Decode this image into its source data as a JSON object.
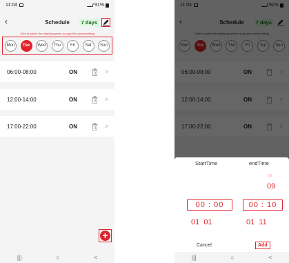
{
  "status_bar": {
    "time": "11:04",
    "battery": "91%"
  },
  "header": {
    "title": "Schedule",
    "days_badge": "7 days"
  },
  "hint": "Click to switch the date/long press to copy the current setting",
  "days": [
    "Mon",
    "Tue",
    "Wed",
    "Thu",
    "Fri",
    "Sat",
    "Sun"
  ],
  "selected_day": "Tue",
  "slots": [
    {
      "time": "06:00-08:00",
      "state": "ON"
    },
    {
      "time": "12:00-14:00",
      "state": "ON"
    },
    {
      "time": "17:00-22:00",
      "state": "ON"
    }
  ],
  "fab": {
    "label": "+"
  },
  "system_nav": {
    "recents": "|||",
    "home": "○",
    "back": "<"
  },
  "picker": {
    "start_label": "StartTime",
    "end_label": "endTime",
    "end_above_faded": "08",
    "end_above": "09",
    "start_selected": "00 : 00",
    "end_selected": "00 : 10",
    "start_below": "01  01",
    "end_below": "01  11",
    "cancel": "Cancel",
    "add": "Add"
  },
  "colors": {
    "accent": "#e0242c",
    "badge_bg": "#dff5df"
  }
}
